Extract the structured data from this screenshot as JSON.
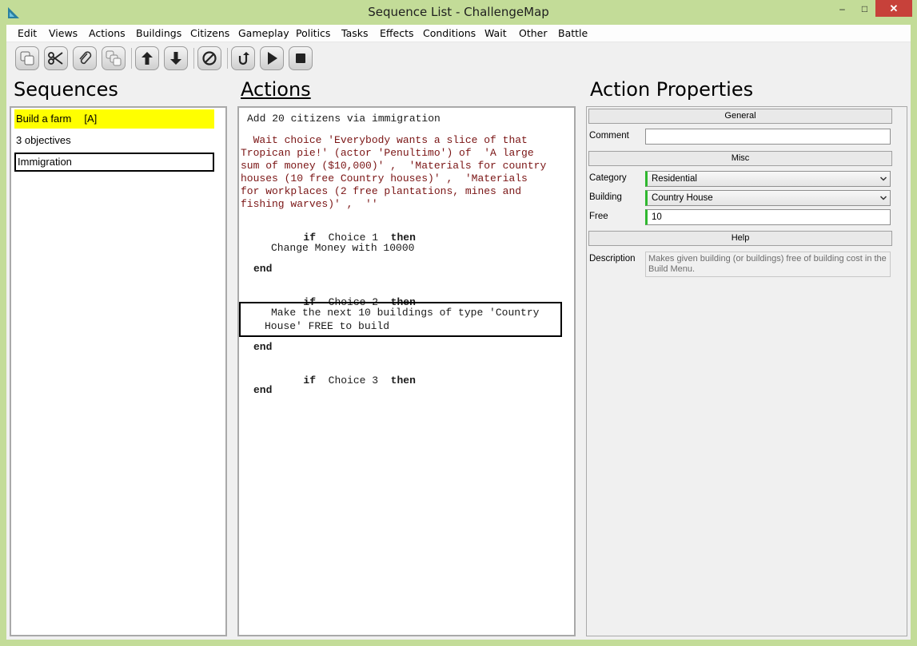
{
  "window": {
    "title": "Sequence List - ChallengeMap",
    "min_glyph": "–",
    "max_glyph": "□",
    "close_glyph": "✕"
  },
  "menu": [
    {
      "label": "Edit"
    },
    {
      "label": "Views"
    },
    {
      "label": "Actions"
    },
    {
      "label": "Buildings"
    },
    {
      "label": "Citizens"
    },
    {
      "label": "Gameplay"
    },
    {
      "label": "Politics"
    },
    {
      "label": "Tasks"
    },
    {
      "label": "Effects"
    },
    {
      "label": "Conditions"
    },
    {
      "label": "Wait"
    },
    {
      "label": "Other"
    },
    {
      "label": "Battle"
    }
  ],
  "toolbar": {
    "icons": [
      "copy-icon",
      "cut-icon",
      "paste-icon",
      "duplicate-icon",
      "arrow-up-icon",
      "arrow-down-icon",
      "disable-icon",
      "undo-icon",
      "play-icon",
      "stop-icon"
    ]
  },
  "sequences": {
    "title": "Sequences",
    "items": [
      {
        "label": "Build a farm",
        "tag": "[A]",
        "state": "highlight"
      },
      {
        "label": "3 objectives",
        "tag": "",
        "state": "normal"
      },
      {
        "label": "Immigration",
        "tag": "",
        "state": "selected"
      }
    ]
  },
  "actions": {
    "title": "Actions",
    "lines": [
      {
        "text": "Add 20 citizens via immigration"
      },
      {
        "text": "  Wait choice 'Everybody wants a slice of that"
      },
      {
        "text": "Tropican pie!' (actor 'Penultimo') of  'A large"
      },
      {
        "text": "sum of money ($10,000)' ,  'Materials for country"
      },
      {
        "text": "houses (10 free Country houses)' ,  'Materials"
      },
      {
        "text": "for workplaces (2 free plantations, mines and"
      },
      {
        "text": "fishing warves)' ,  ''"
      },
      {
        "kw": "if",
        "cond": "Choice 1",
        "then": "then"
      },
      {
        "text": "Change Money with 10000"
      },
      {
        "kw": "end"
      },
      {
        "kw": "if",
        "cond": "Choice 2",
        "then": "then"
      },
      {
        "text": "Make the next 10 buildings of type 'Country"
      },
      {
        "text": "House' FREE to build"
      },
      {
        "kw": "end"
      },
      {
        "kw": "if",
        "cond": "Choice 3",
        "then": "then"
      },
      {
        "kw": "end"
      }
    ]
  },
  "properties": {
    "title": "Action Properties",
    "general_header": "General",
    "comment_label": "Comment",
    "comment_value": "",
    "misc_header": "Misc",
    "category_label": "Category",
    "category_value": "Residential",
    "building_label": "Building",
    "building_value": "Country House",
    "free_label": "Free",
    "free_value": "10",
    "help_header": "Help",
    "description_label": "Description",
    "description_value": "Makes given building (or buildings) free of building cost in the Build Menu."
  }
}
